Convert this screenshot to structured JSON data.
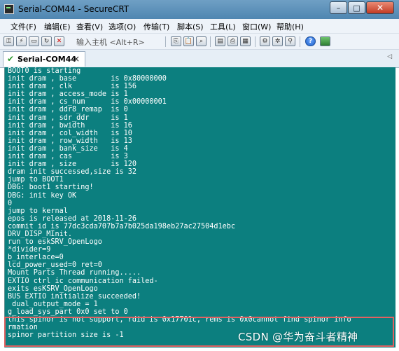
{
  "window": {
    "title": "Serial-COM44 - SecureCRT",
    "buttons": {
      "minimize": "–",
      "maximize": "□",
      "close": "✕"
    }
  },
  "menu": [
    "文件(F)",
    "编辑(E)",
    "查看(V)",
    "选项(O)",
    "传输(T)",
    "脚本(S)",
    "工具(L)",
    "窗口(W)",
    "帮助(H)"
  ],
  "toolbar": {
    "quick_connect": "输入主机 <Alt+R>",
    "icons": [
      "connect-icon",
      "quick-connect-icon",
      "connect-tab-icon",
      "reconnect-icon",
      "disconnect-icon",
      "copy-icon",
      "paste-icon",
      "find-icon",
      "print-setup-icon",
      "print-icon",
      "log-icon",
      "session-options-icon",
      "global-options-icon",
      "keymap-icon",
      "help-icon",
      "sftp-icon"
    ]
  },
  "tab": {
    "label": "Serial-COM44",
    "close": "×"
  },
  "terminal": {
    "lines": [
      "BOOT0 is starting",
      "init dram , base        is 0x80000000",
      "init dram , clk         is 156",
      "init dram , access_mode is 1",
      "init dram , cs_num      is 0x00000001",
      "init dram , ddr8_remap  is 0",
      "init dram , sdr_ddr     is 1",
      "init dram , bwidth      is 16",
      "init dram , col_width   is 10",
      "init dram , row_width   is 13",
      "init dram , bank_size   is 4",
      "init dram , cas         is 3",
      "init dram , size        is 120",
      "dram init successed,size is 32",
      "jump to BOOT1",
      "DBG: boot1 starting!",
      "DBG: init key OK",
      "0",
      "jump to kernal",
      "epos is released at 2018-11-26",
      "commit id is 77dc3cda707b7a7b025da198eb27ac27504d1ebc",
      "DRV_DISP_MInit.",
      "run to eskSRV_OpenLogo",
      "*divider=9",
      "b_interlace=0",
      "lcd_power_used=0 ret=0",
      "Mount Parts Thread running.....",
      "EXTIO ctrl ic communication failed-",
      "exits esKSRV_OpenLogo",
      "BUS EXTIO initialize succeeded!",
      " dual_output_mode = 1",
      "g_load_sys_part 0x0 set to 0",
      "this spinor is not support, rdid is 0x17701c, rems is 0x0cannot find spinor info",
      "rmation",
      "spinor partition size is -1"
    ]
  },
  "watermark": "CSDN @华为奋斗者精神"
}
